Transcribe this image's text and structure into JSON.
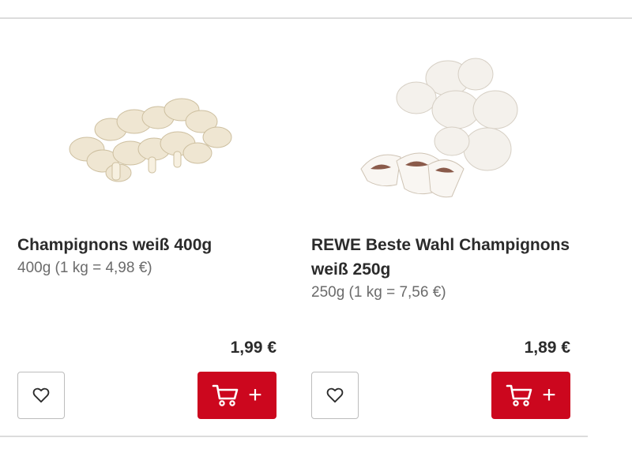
{
  "products": [
    {
      "name": "Champignons weiß 400g",
      "grammage": "400g (1 kg = 4,98 €)",
      "price": "1,99 €"
    },
    {
      "name": "REWE Beste Wahl Champignons weiß 250g",
      "grammage": "250g (1 kg = 7,56 €)",
      "price": "1,89 €"
    }
  ],
  "icons": {
    "favorite": "heart-outline-icon",
    "add_to_cart": "cart-icon",
    "add": "plus-icon"
  },
  "colors": {
    "brand_red": "#cc071e",
    "text": "#2b2b2b",
    "muted": "#6b6b6b",
    "divider": "#dcdcdc"
  }
}
